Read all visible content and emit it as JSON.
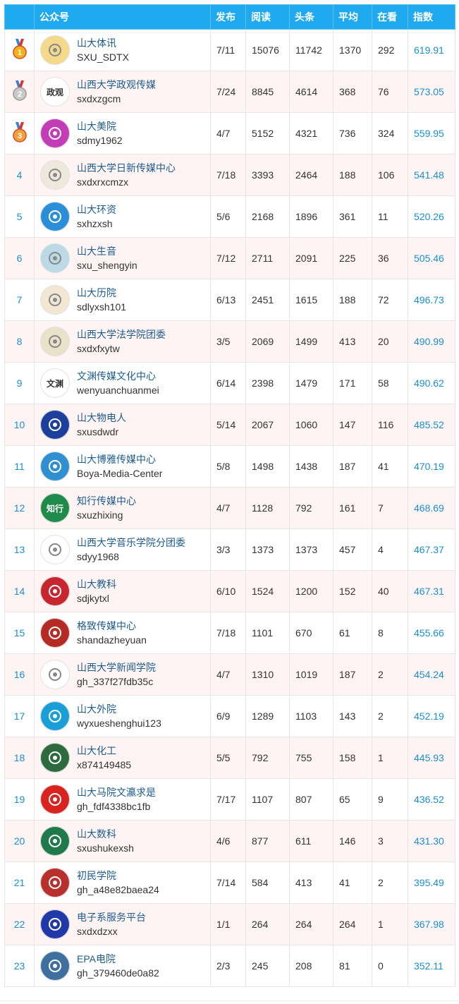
{
  "headers": [
    "",
    "公众号",
    "发布",
    "阅读",
    "头条",
    "平均",
    "在看",
    "指数"
  ],
  "rows": [
    {
      "rank": "1",
      "medal": "gold",
      "cn": "山大体讯",
      "en": "SXU_SDTX",
      "pub": "7/11",
      "read": "15076",
      "head": "11742",
      "avg": "1370",
      "look": "292",
      "index": "619.91",
      "avatar_color": "#f4d98b",
      "avatar_icon": "school-logo-icon"
    },
    {
      "rank": "2",
      "medal": "silver",
      "cn": "山西大学政观传媒",
      "en": "sxdxzgcm",
      "pub": "7/24",
      "read": "8845",
      "head": "4614",
      "avg": "368",
      "look": "76",
      "index": "573.05",
      "avatar_color": "#ffffff",
      "avatar_icon": "calligraphy-logo-icon",
      "avatar_text": "政观"
    },
    {
      "rank": "3",
      "medal": "bronze",
      "cn": "山大美院",
      "en": "sdmy1962",
      "pub": "4/7",
      "read": "5152",
      "head": "4321",
      "avg": "736",
      "look": "324",
      "index": "559.95",
      "avatar_color": "#c23cb5",
      "avatar_icon": "colorful-paint-icon"
    },
    {
      "rank": "4",
      "cn": "山西大学日新传媒中心",
      "en": "sxdxrxcmzx",
      "pub": "7/18",
      "read": "3393",
      "head": "2464",
      "avg": "188",
      "look": "106",
      "index": "541.48",
      "avatar_color": "#efe8dc",
      "avatar_icon": "pattern-logo-icon"
    },
    {
      "rank": "5",
      "cn": "山大环资",
      "en": "sxhzxsh",
      "pub": "5/6",
      "read": "2168",
      "head": "1896",
      "avg": "361",
      "look": "11",
      "index": "520.26",
      "avatar_color": "#2a8ed8",
      "avatar_icon": "swirl-logo-icon"
    },
    {
      "rank": "6",
      "cn": "山大生音",
      "en": "sxu_shengyin",
      "pub": "7/12",
      "read": "2711",
      "head": "2091",
      "avg": "225",
      "look": "36",
      "index": "505.46",
      "avatar_color": "#bcd9e6",
      "avatar_icon": "butterfly-icon"
    },
    {
      "rank": "7",
      "cn": "山大历院",
      "en": "sdlyxsh101",
      "pub": "6/13",
      "read": "2451",
      "head": "1615",
      "avg": "188",
      "look": "72",
      "index": "496.73",
      "avatar_color": "#f1e7d2",
      "avatar_icon": "building-icon"
    },
    {
      "rank": "8",
      "cn": "山西大学法学院团委",
      "en": "sxdxfxytw",
      "pub": "3/5",
      "read": "2069",
      "head": "1499",
      "avg": "413",
      "look": "20",
      "index": "490.99",
      "avatar_color": "#e9e1c8",
      "avatar_icon": "emblem-icon"
    },
    {
      "rank": "9",
      "cn": "文渊传媒文化中心",
      "en": "wenyuanchuanmei",
      "pub": "6/14",
      "read": "2398",
      "head": "1479",
      "avg": "171",
      "look": "58",
      "index": "490.62",
      "avatar_color": "#ffffff",
      "avatar_icon": "ink-logo-icon",
      "avatar_text": "文渊"
    },
    {
      "rank": "10",
      "cn": "山大物电人",
      "en": "sxusdwdr",
      "pub": "5/14",
      "read": "2067",
      "head": "1060",
      "avg": "147",
      "look": "116",
      "index": "485.52",
      "avatar_color": "#1b3f9a",
      "avatar_icon": "circle-seal-icon"
    },
    {
      "rank": "11",
      "cn": "山大博雅传媒中心",
      "en": "Boya-Media-Center",
      "pub": "5/8",
      "read": "1498",
      "head": "1438",
      "avg": "187",
      "look": "41",
      "index": "470.19",
      "avatar_color": "#2f8fd1",
      "avatar_icon": "wave-logo-icon"
    },
    {
      "rank": "12",
      "cn": "知行传媒中心",
      "en": "sxuzhixing",
      "pub": "4/7",
      "read": "1128",
      "head": "792",
      "avg": "161",
      "look": "7",
      "index": "468.69",
      "avatar_color": "#1f8a4a",
      "avatar_icon": "leaf-logo-icon",
      "avatar_text": "知行"
    },
    {
      "rank": "13",
      "cn": "山西大学音乐学院分团委",
      "en": "sdyy1968",
      "pub": "3/3",
      "read": "1373",
      "head": "1373",
      "avg": "457",
      "look": "4",
      "index": "467.37",
      "avatar_color": "#ffffff",
      "avatar_icon": "music-note-icon"
    },
    {
      "rank": "14",
      "cn": "山大教科",
      "en": "sdjkytxl",
      "pub": "6/10",
      "read": "1524",
      "head": "1200",
      "avg": "152",
      "look": "40",
      "index": "467.31",
      "avatar_color": "#c7262e",
      "avatar_icon": "red-seal-icon"
    },
    {
      "rank": "15",
      "cn": "格致传媒中心",
      "en": "shandazheyuan",
      "pub": "7/18",
      "read": "1101",
      "head": "670",
      "avg": "61",
      "look": "8",
      "index": "455.66",
      "avatar_color": "#b52a22",
      "avatar_icon": "square-seal-icon"
    },
    {
      "rank": "16",
      "cn": "山西大学新闻学院",
      "en": "gh_337f27fdb35c",
      "pub": "4/7",
      "read": "1310",
      "head": "1019",
      "avg": "187",
      "look": "2",
      "index": "454.24",
      "avatar_color": "#ffffff",
      "avatar_icon": "banner-logo-icon"
    },
    {
      "rank": "17",
      "cn": "山大外院",
      "en": "wyxueshenghui123",
      "pub": "6/9",
      "read": "1289",
      "head": "1103",
      "avg": "143",
      "look": "2",
      "index": "452.19",
      "avatar_color": "#1a9ed7",
      "avatar_icon": "globe-icon"
    },
    {
      "rank": "18",
      "cn": "山大化工",
      "en": "x874149485",
      "pub": "5/5",
      "read": "792",
      "head": "755",
      "avg": "158",
      "look": "1",
      "index": "445.93",
      "avatar_color": "#2d6b3f",
      "avatar_icon": "house-logo-icon"
    },
    {
      "rank": "19",
      "cn": "山大马院文瀛求是",
      "en": "gh_fdf4338bc1fb",
      "pub": "7/17",
      "read": "1107",
      "head": "807",
      "avg": "65",
      "look": "9",
      "index": "436.52",
      "avatar_color": "#d8231f",
      "avatar_icon": "cube-icon"
    },
    {
      "rank": "20",
      "cn": "山大数科",
      "en": "sxushukexsh",
      "pub": "4/6",
      "read": "877",
      "head": "611",
      "avg": "146",
      "look": "3",
      "index": "431.30",
      "avatar_color": "#1e7a4a",
      "avatar_icon": "gate-icon"
    },
    {
      "rank": "21",
      "cn": "初民学院",
      "en": "gh_a48e82baea24",
      "pub": "7/14",
      "read": "584",
      "head": "413",
      "avg": "41",
      "look": "2",
      "index": "395.49",
      "avatar_color": "#b8302c",
      "avatar_icon": "round-seal-icon"
    },
    {
      "rank": "22",
      "cn": "电子系服务平台",
      "en": "sxdxdzxx",
      "pub": "1/1",
      "read": "264",
      "head": "264",
      "avg": "264",
      "look": "1",
      "index": "367.98",
      "avatar_color": "#2139a8",
      "avatar_icon": "e-letter-icon"
    },
    {
      "rank": "23",
      "cn": "EPA电院",
      "en": "gh_379460de0a82",
      "pub": "2/3",
      "read": "245",
      "head": "208",
      "avg": "81",
      "look": "0",
      "index": "352.11",
      "avatar_color": "#3f6f9e",
      "avatar_icon": "school-emblem-icon"
    }
  ],
  "colors": {
    "header_bg": "#1fa9ef",
    "alt_row": "#fff4f4",
    "link": "#1a8fd0",
    "name": "#1e5b8a"
  }
}
